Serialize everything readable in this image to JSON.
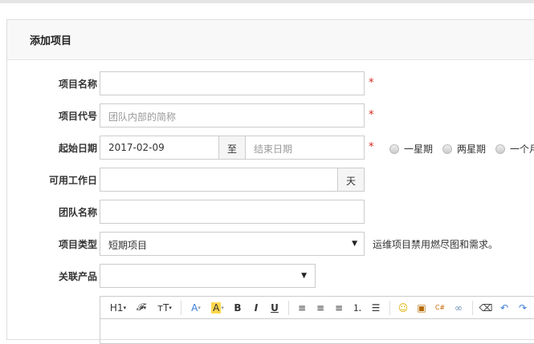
{
  "panel": {
    "title": "添加项目"
  },
  "form": {
    "name": {
      "label": "项目名称",
      "value": ""
    },
    "code": {
      "label": "项目代号",
      "placeholder": "团队内部的简称"
    },
    "dates": {
      "label": "起始日期",
      "begin": "2017-02-09",
      "to": "至",
      "end_placeholder": "结束日期",
      "options": [
        "一星期",
        "两星期",
        "一个月"
      ]
    },
    "days": {
      "label": "可用工作日",
      "value": "",
      "unit": "天"
    },
    "team": {
      "label": "团队名称",
      "value": ""
    },
    "type": {
      "label": "项目类型",
      "value": "短期项目",
      "hint": "运维项目禁用燃尽图和需求。"
    },
    "product": {
      "label": "关联产品",
      "value": ""
    },
    "required": "*"
  },
  "editor": {
    "tools": [
      "H1",
      "𝓕",
      "тT",
      "A",
      "A",
      "B",
      "I",
      "U"
    ]
  },
  "colors": {
    "required": "#d9231d",
    "highlight": "#ffd84d",
    "fontcolor": "#3a7bd5"
  }
}
